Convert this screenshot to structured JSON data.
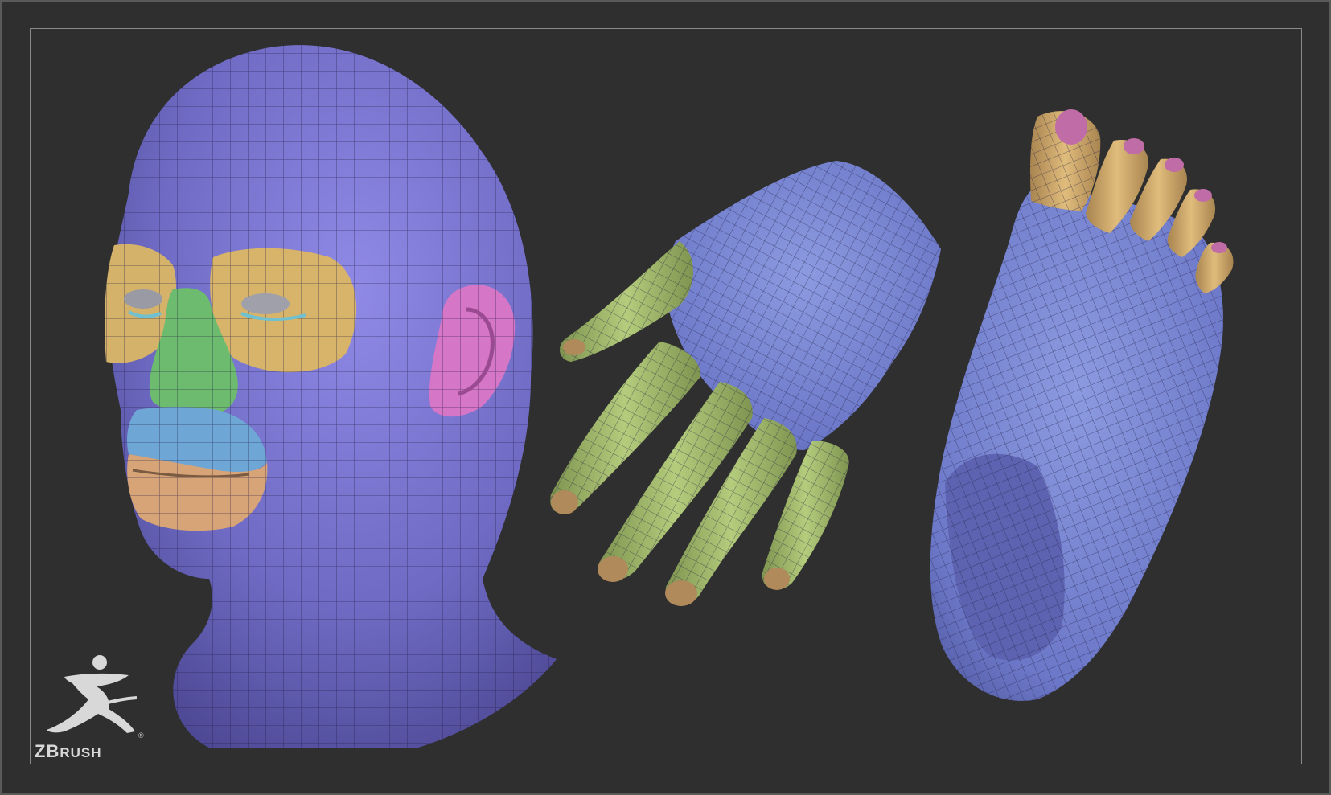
{
  "logo": {
    "brand": "ZBRUSH",
    "brand_first": "ZB",
    "brand_rest": "RUSH",
    "icon": "zbrush-figure-logo"
  },
  "colors": {
    "background": "#2f2f2f",
    "frame_border": "#8a8a8a",
    "skin_purple": "#7470c8",
    "eye_yellow": "#d8b46a",
    "nose_green": "#6fbd70",
    "lip_blue": "#6fa8d8",
    "mouth_peach": "#d9a57a",
    "ear_pink": "#d878c8",
    "finger_green": "#a8c070",
    "nail_brown": "#b08a5a",
    "toe_tan": "#d8b070",
    "nail_pink": "#c070a8"
  },
  "models": [
    {
      "name": "head"
    },
    {
      "name": "hand"
    },
    {
      "name": "foot"
    }
  ]
}
